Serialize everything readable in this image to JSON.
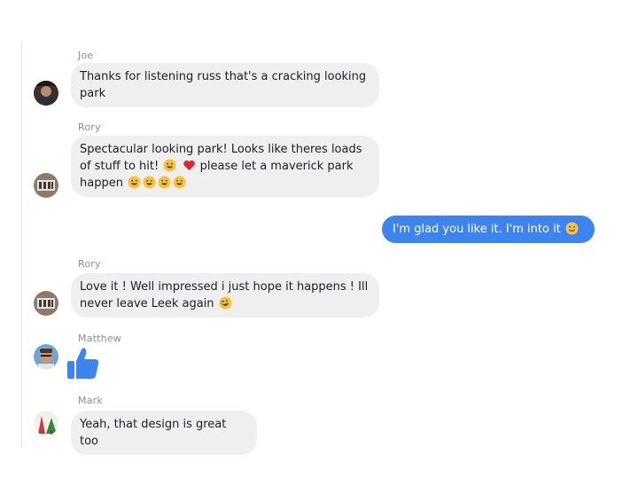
{
  "conversation": {
    "messages": [
      {
        "sender": "Joe",
        "lines": [
          "Thanks for listening russ that's a cracking looking",
          "park"
        ]
      },
      {
        "sender": "Rory",
        "line1": "Spectacular looking park! Looks like theres loads",
        "line2a": "of stuff to hit!",
        "line2b": "please let a maverick park",
        "line3": "happen"
      },
      {
        "text": "I'm glad you like it.  I'm into it"
      },
      {
        "sender": "Rory",
        "line1": "Love it ! Well impressed i just hope it happens ! Ill",
        "line2": "never leave Leek again"
      },
      {
        "sender": "Matthew",
        "content": "like"
      },
      {
        "sender": "Mark",
        "text": "Yeah, that design is great too"
      }
    ]
  },
  "icons": {
    "like": "thumbs-up-icon",
    "grin": "grinning-face-icon",
    "heart": "red-heart-icon",
    "smile": "smiling-face-icon",
    "laugh": "rolling-laughing-icon"
  },
  "colors": {
    "outgoing_bubble": "#3c84ef",
    "incoming_bubble": "#efefef",
    "sender_name": "#8a8d91",
    "like_blue": "#3c84ef"
  }
}
